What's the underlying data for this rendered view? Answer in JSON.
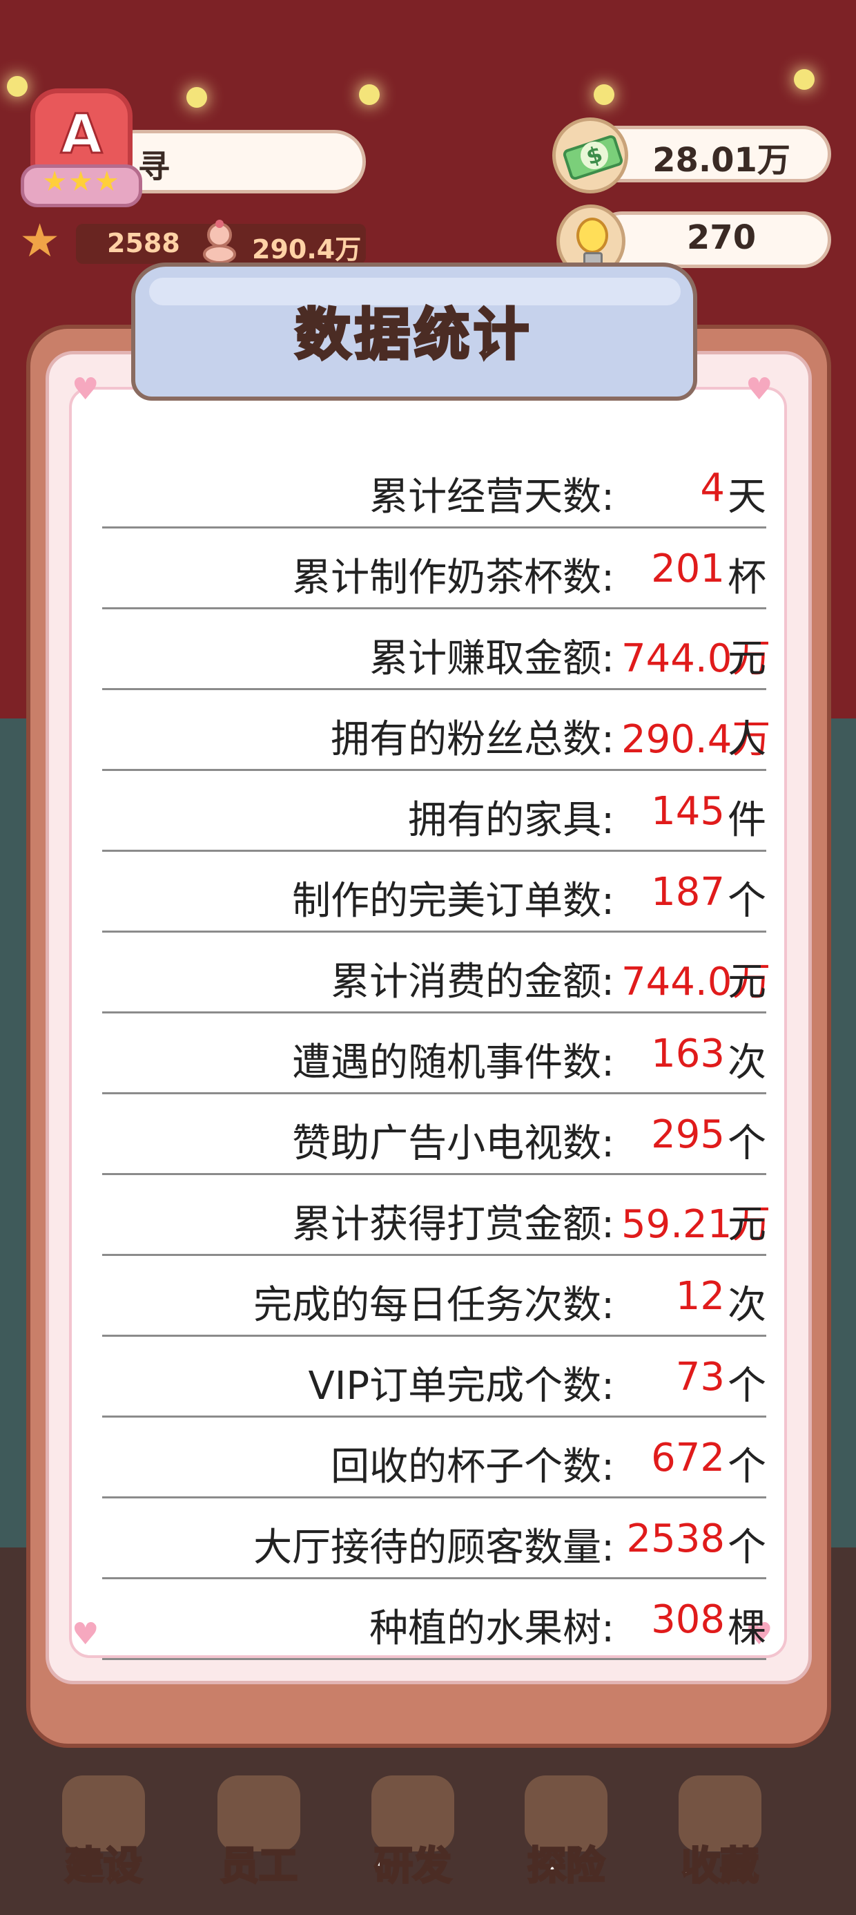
{
  "player": {
    "name": "寻",
    "rank_letter": "A",
    "rank_stars": "★★★",
    "stars": "2588",
    "fans": "290.4万"
  },
  "resources": {
    "money": "28.01万",
    "ideas": "270"
  },
  "panel": {
    "title": "数据统计",
    "stats": [
      {
        "label": "累计经营天数:",
        "value": "4",
        "unit": "天"
      },
      {
        "label": "累计制作奶茶杯数:",
        "value": "201",
        "unit": "杯"
      },
      {
        "label": "累计赚取金额:",
        "value": "744.0万",
        "unit": "元"
      },
      {
        "label": "拥有的粉丝总数:",
        "value": "290.4万",
        "unit": "人"
      },
      {
        "label": "拥有的家具:",
        "value": "145",
        "unit": "件"
      },
      {
        "label": "制作的完美订单数:",
        "value": "187",
        "unit": "个"
      },
      {
        "label": "累计消费的金额:",
        "value": "744.0万",
        "unit": "元"
      },
      {
        "label": "遭遇的随机事件数:",
        "value": "163",
        "unit": "次"
      },
      {
        "label": "赞助广告小电视数:",
        "value": "295",
        "unit": "个"
      },
      {
        "label": "累计获得打赏金额:",
        "value": "59.21万",
        "unit": "元"
      },
      {
        "label": "完成的每日任务次数:",
        "value": "12",
        "unit": "次"
      },
      {
        "label": "VIP订单完成个数:",
        "value": "73",
        "unit": "个"
      },
      {
        "label": "回收的杯子个数:",
        "value": "672",
        "unit": "个"
      },
      {
        "label": "大厅接待的顾客数量:",
        "value": "2538",
        "unit": "个"
      },
      {
        "label": "种植的水果树:",
        "value": "308",
        "unit": "棵"
      }
    ]
  },
  "nav": {
    "items": [
      {
        "label": "建设",
        "icon": "hammer-icon"
      },
      {
        "label": "员工",
        "icon": "staff-icon"
      },
      {
        "label": "研发",
        "icon": "drink-icon"
      },
      {
        "label": "探险",
        "icon": "compass-icon"
      },
      {
        "label": "收藏",
        "icon": "book-icon"
      }
    ]
  },
  "colors": {
    "value_red": "#e01b1b",
    "panel_brown": "#c97f69",
    "title_blue": "#c6d2ec"
  }
}
